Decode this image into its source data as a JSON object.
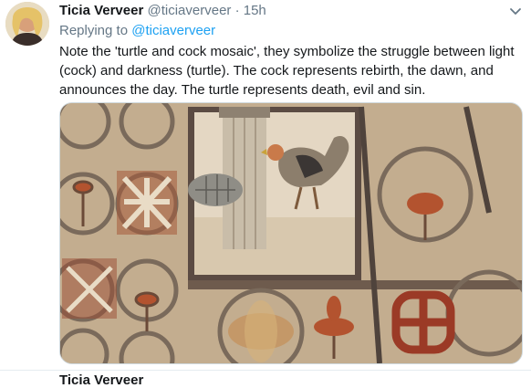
{
  "tweet": {
    "author_name": "Ticia Verveer",
    "handle": "@ticiaverveer",
    "separator": "·",
    "time": "15h",
    "reply_prefix": "Replying to",
    "reply_handle": "@ticiaverveer",
    "text": "Note the 'turtle and cock mosaic', they symbolize the struggle between light (cock) and darkness (turtle). The cock represents rebirth, the dawn, and announces the day. The turtle represents death, evil and sin.",
    "media_icon": "mosaic-photo"
  },
  "next_tweet": {
    "author_name": "Ticia Verveer"
  },
  "colors": {
    "link": "#1da1f2",
    "muted": "#657786",
    "text": "#14171a"
  }
}
